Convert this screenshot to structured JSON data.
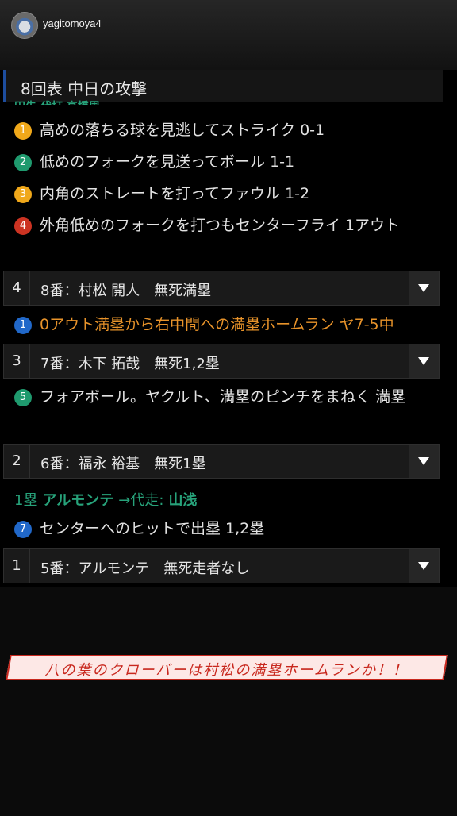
{
  "profile": {
    "username": "yagitomoya4"
  },
  "section": {
    "title": "8回表 中日の攻撃",
    "cutoff_text": "田先 代打 高橋周"
  },
  "plays_top": [
    {
      "n": "1",
      "text": "高めの落ちる球を見逃してストライク 0-1"
    },
    {
      "n": "2",
      "text": "低めのフォークを見送ってボール 1-1"
    },
    {
      "n": "3",
      "text": "内角のストレートを打ってファウル 1-2"
    },
    {
      "n": "4",
      "text": "外角低めのフォークを打つもセンターフライ 1アウト"
    }
  ],
  "at_bats": [
    {
      "n": "4",
      "label": "8番：村松 開人　無死満塁"
    },
    {
      "n": "3",
      "label": "7番：木下 拓哉　無死1,2塁"
    },
    {
      "n": "2",
      "label": "6番：福永 裕基　無死1塁"
    },
    {
      "n": "1",
      "label": "5番：アルモンテ　無死走者なし"
    }
  ],
  "homerun_play": {
    "n": "1",
    "text": "0アウト満塁から右中間への満塁ホームラン ヤ7-5中"
  },
  "walk_play": {
    "n": "5",
    "text": "フォアボール。ヤクルト、満塁のピンチをまねく 満塁"
  },
  "substitution": {
    "base": "1塁",
    "player": "アルモンテ",
    "arrow": "→代走:",
    "runner": "山浅"
  },
  "hit_play": {
    "n": "7",
    "text": "センターへのヒットで出塁 1,2塁"
  },
  "caption": "八の葉のクローバーは村松の満塁ホームランか！！",
  "colors": {
    "accent_blue": "#1d4d9e",
    "homerun_orange": "#e8932a",
    "sub_green": "#27a27a",
    "caption_red": "#c8281e"
  }
}
